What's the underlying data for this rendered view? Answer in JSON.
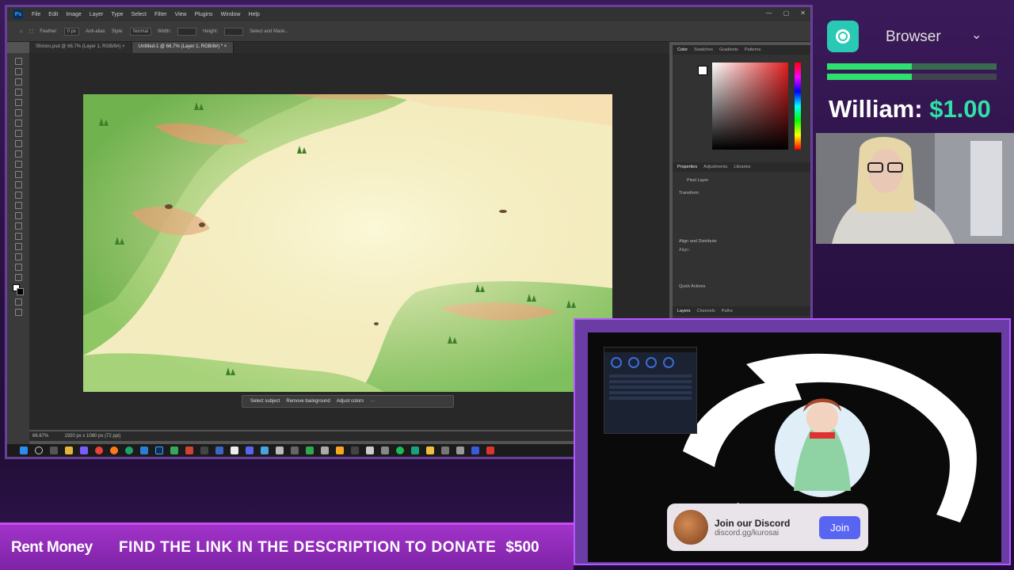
{
  "photoshop": {
    "app_logo": "Ps",
    "menu": [
      "File",
      "Edit",
      "Image",
      "Layer",
      "Type",
      "Select",
      "Filter",
      "View",
      "Plugins",
      "Window",
      "Help"
    ],
    "options": {
      "feather_label": "Feather:",
      "feather_value": "0 px",
      "anti_alias": "Anti-alias",
      "style_label": "Style:",
      "style_value": "Normal",
      "width_label": "Width:",
      "height_label": "Height:",
      "select_mask": "Select and Mask..."
    },
    "tabs": [
      {
        "label": "Shiroru.psd @ 66.7% (Layer 1, RGB/8#) ×"
      },
      {
        "label": "Untitled-1 @ 66.7% (Layer 1, RGB/8#) * ×"
      }
    ],
    "context_bar": {
      "select_subject": "Select subject",
      "remove_background": "Remove background",
      "adjust_colors": "Adjust colors"
    },
    "status": {
      "zoom": "66.67%",
      "doc_size": "1920 px x 1080 px (72 ppi)"
    },
    "right_panel": {
      "color_tabs": [
        "Color",
        "Swatches",
        "Gradients",
        "Patterns"
      ],
      "props_tabs": [
        "Properties",
        "Adjustments",
        "Libraries"
      ],
      "pixel_layer": "Pixel Layer",
      "transform": "Transform",
      "align_distribute": "Align and Distribute",
      "align_label": "Align:",
      "quick_actions": "Quick Actions",
      "layers_tabs": [
        "Layers",
        "Channels",
        "Paths"
      ]
    },
    "window_controls": [
      "—",
      "▢",
      "✕"
    ]
  },
  "overlay": {
    "browser_label": "Browser",
    "browser_chevron": "⌄",
    "progress_fraction": 0.5,
    "donor_name": "William:",
    "donor_amount": "$1.00",
    "discord": {
      "title": "Join our Discord",
      "link": "discord.gg/kurosai",
      "join": "Join"
    },
    "ticker": {
      "label": "Rent Money",
      "message": "FIND THE LINK IN THE DESCRIPTION TO DONATE",
      "amount": "$500"
    }
  },
  "colors": {
    "accent": "#b05cff",
    "ticker": "#9b2fc4",
    "brand_green": "#2ee06e",
    "discord_blue": "#5865f2",
    "ps_blue": "#31a8ff"
  }
}
